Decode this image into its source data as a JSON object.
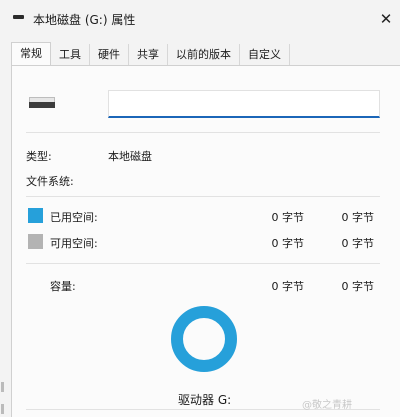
{
  "window": {
    "title": "本地磁盘 (G:) 属性",
    "close_glyph": "✕",
    "icon": "drive-icon"
  },
  "tabs": [
    {
      "label": "常规",
      "active": true
    },
    {
      "label": "工具",
      "active": false
    },
    {
      "label": "硬件",
      "active": false
    },
    {
      "label": "共享",
      "active": false
    },
    {
      "label": "以前的版本",
      "active": false
    },
    {
      "label": "自定义",
      "active": false
    }
  ],
  "general": {
    "name_value": "",
    "type_label": "类型:",
    "type_value": "本地磁盘",
    "fs_label": "文件系统:",
    "fs_value": "",
    "used_label": "已用空间:",
    "used_bytes": "0 字节",
    "used_size": "0 字节",
    "free_label": "可用空间:",
    "free_bytes": "0 字节",
    "free_size": "0 字节",
    "capacity_label": "容量:",
    "capacity_bytes": "0 字节",
    "capacity_size": "0 字节",
    "drive_label": "驱动器 G:"
  },
  "colors": {
    "used": "#26a0da",
    "free": "#b3b3b3",
    "accent": "#1b66b8"
  },
  "watermark": "@敬之青耕"
}
